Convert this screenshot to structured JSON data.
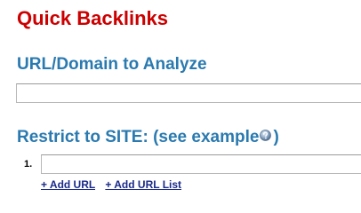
{
  "title": "Quick Backlinks",
  "url_section": {
    "heading": "URL/Domain to Analyze",
    "input_value": ""
  },
  "site_section": {
    "heading_prefix": "Restrict to SITE: (see example",
    "heading_suffix": ")",
    "help_icon": "help-icon",
    "rows": [
      {
        "number": "1.",
        "value": ""
      }
    ],
    "add_url_label": "+ Add URL",
    "add_url_list_label": "+ Add URL List"
  },
  "colors": {
    "title": "#cc0000",
    "heading": "#2a7ab0",
    "link": "#1a2a8a"
  }
}
